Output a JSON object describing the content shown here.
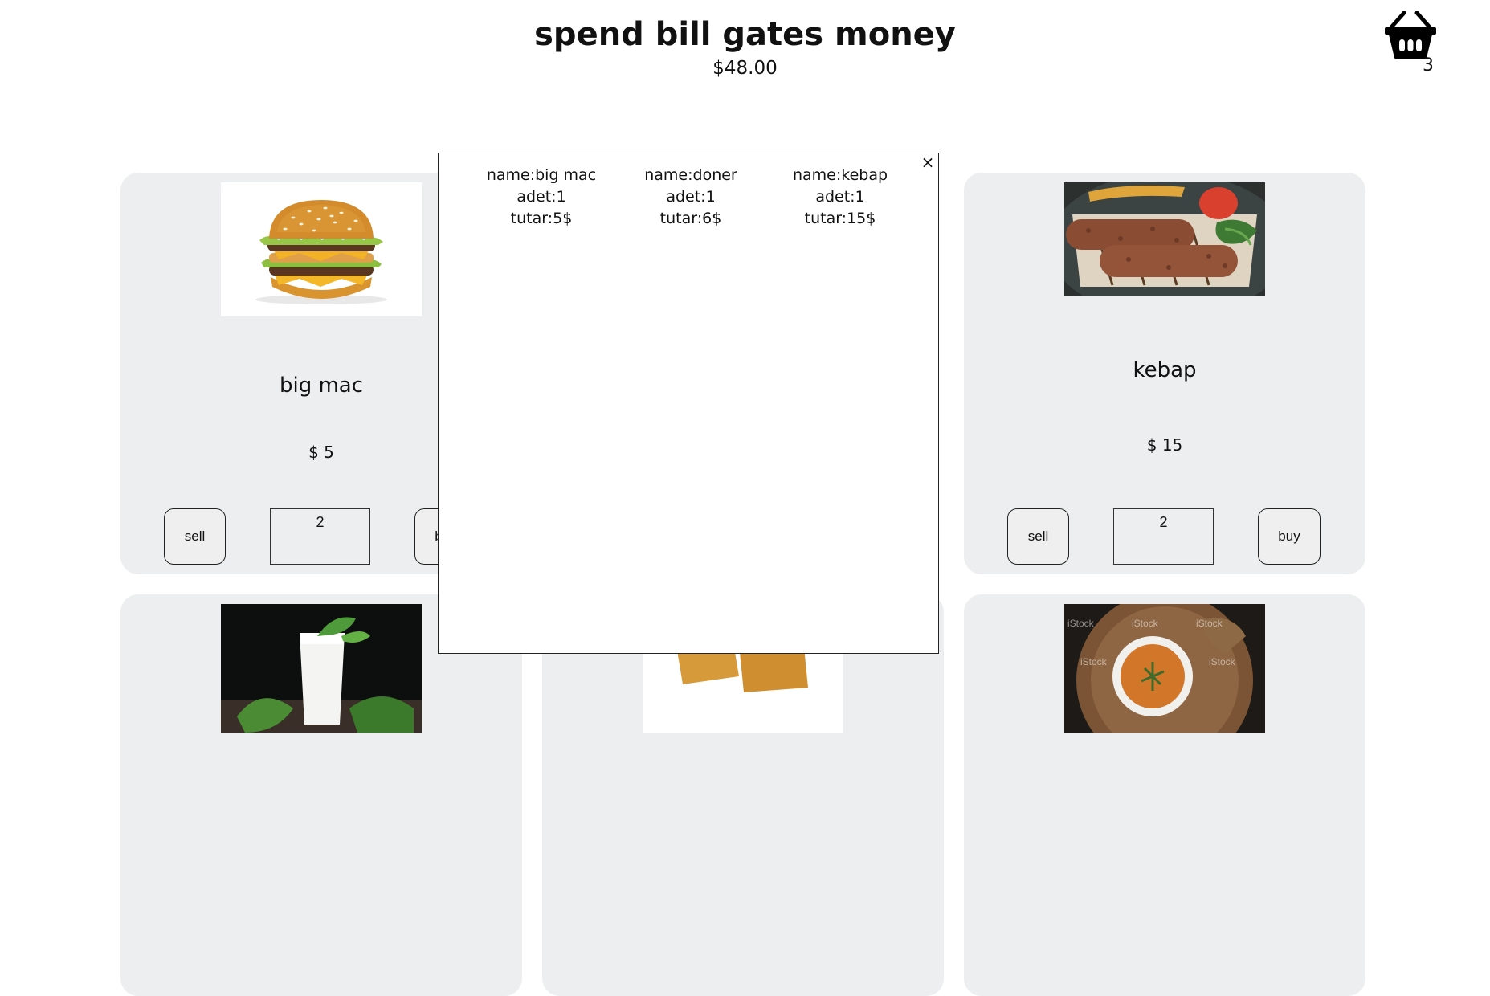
{
  "header": {
    "title": "spend bill gates money",
    "money": "$48.00",
    "basket_count": "3"
  },
  "icons": {
    "basket": "basket-icon",
    "close": "close-icon"
  },
  "products": [
    {
      "name": "big mac",
      "price": "$ 5",
      "sell_label": "sell",
      "quantity": "2",
      "buy_label": "buy"
    },
    {
      "name": "kebap",
      "price": "$ 15",
      "sell_label": "sell",
      "quantity": "2",
      "buy_label": "buy"
    }
  ],
  "cart_modal": {
    "close_symbol": "×",
    "items": [
      {
        "name": "name:big mac",
        "adet": "adet:1",
        "tutar": "tutar:5$"
      },
      {
        "name": "name:doner",
        "adet": "adet:1",
        "tutar": "tutar:6$"
      },
      {
        "name": "name:kebap",
        "adet": "adet:1",
        "tutar": "tutar:15$"
      }
    ]
  }
}
